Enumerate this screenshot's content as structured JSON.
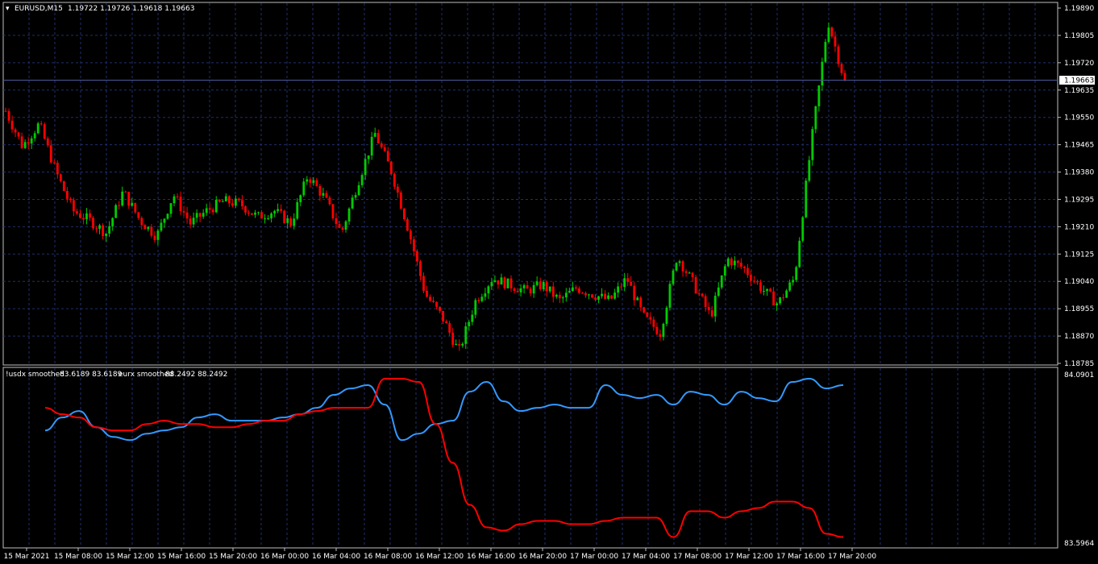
{
  "main_chart": {
    "symbol_timeframe": "EURUSD,M15",
    "ohlc": "1.19722 1.19726 1.19618 1.19663",
    "current_price": "1.19663",
    "price_axis": [
      "1.19890",
      "1.19805",
      "1.19720",
      "1.19635",
      "1.19550",
      "1.19465",
      "1.19380",
      "1.19295",
      "1.19210",
      "1.19125",
      "1.19040",
      "1.18955",
      "1.18870",
      "1.18785"
    ]
  },
  "indicator": {
    "series": [
      {
        "name": "usdx smoothed",
        "label": "!usdx smoothed",
        "values": "83.6189 83.6189",
        "color": "#ff0000"
      },
      {
        "name": "eurx smoothed",
        "label": "eurx smoothed",
        "values": "88.2492 88.2492",
        "color": "#3399ff"
      }
    ],
    "axis_top": "84.0901",
    "axis_bottom": "83.5964"
  },
  "time_axis": [
    "15 Mar 2021",
    "15 Mar 08:00",
    "15 Mar 12:00",
    "15 Mar 16:00",
    "15 Mar 20:00",
    "16 Mar 00:00",
    "16 Mar 04:00",
    "16 Mar 08:00",
    "16 Mar 12:00",
    "16 Mar 16:00",
    "16 Mar 20:00",
    "17 Mar 00:00",
    "17 Mar 04:00",
    "17 Mar 08:00",
    "17 Mar 12:00",
    "17 Mar 16:00",
    "17 Mar 20:00"
  ],
  "colors": {
    "bull": "#00cc00",
    "bear": "#ff0000",
    "grid": "#1f2f6e",
    "axis": "#ffffff",
    "background": "#000000"
  },
  "chart_data": [
    {
      "type": "candlestick",
      "title": "EURUSD,M15",
      "ylim": [
        1.18785,
        1.1989
      ],
      "x": [
        "15 Mar 2021",
        "15 Mar 08:00",
        "15 Mar 12:00",
        "15 Mar 16:00",
        "15 Mar 20:00",
        "16 Mar 00:00",
        "16 Mar 04:00",
        "16 Mar 08:00",
        "16 Mar 12:00",
        "16 Mar 16:00",
        "16 Mar 20:00",
        "17 Mar 00:00",
        "17 Mar 04:00",
        "17 Mar 08:00",
        "17 Mar 12:00",
        "17 Mar 16:00",
        "17 Mar 20:00"
      ],
      "close_path": [
        1.1957,
        1.1946,
        1.1953,
        1.1938,
        1.1926,
        1.1923,
        1.1919,
        1.1932,
        1.1923,
        1.1918,
        1.1931,
        1.1922,
        1.1926,
        1.1929,
        1.1928,
        1.1924,
        1.1926,
        1.1922,
        1.1937,
        1.193,
        1.1919,
        1.1935,
        1.195,
        1.1938,
        1.192,
        1.19,
        1.1893,
        1.1882,
        1.1898,
        1.1905,
        1.1903,
        1.1901,
        1.1903,
        1.1898,
        1.1902,
        1.19,
        1.1898,
        1.1905,
        1.1893,
        1.1888,
        1.1912,
        1.1903,
        1.1893,
        1.1911,
        1.1908,
        1.1902,
        1.1897,
        1.1905,
        1.1947,
        1.1985,
        1.1966
      ],
      "grid": true
    },
    {
      "type": "line",
      "ylim": [
        83.5964,
        84.0901
      ],
      "x": [
        "15 Mar 2021",
        "15 Mar 08:00",
        "15 Mar 12:00",
        "15 Mar 16:00",
        "15 Mar 20:00",
        "16 Mar 00:00",
        "16 Mar 04:00",
        "16 Mar 08:00",
        "16 Mar 12:00",
        "16 Mar 16:00",
        "16 Mar 20:00",
        "17 Mar 00:00",
        "17 Mar 04:00",
        "17 Mar 08:00",
        "17 Mar 12:00",
        "17 Mar 16:00",
        "17 Mar 20:00"
      ],
      "series": [
        {
          "name": "usdx smoothed",
          "values": [
            84.0,
            83.98,
            83.97,
            83.94,
            83.93,
            83.93,
            83.95,
            83.96,
            83.95,
            83.95,
            83.94,
            83.94,
            83.95,
            83.96,
            83.96,
            83.98,
            83.99,
            84.0,
            84.0,
            84.0,
            84.09,
            84.09,
            84.08,
            83.95,
            83.83,
            83.7,
            83.63,
            83.62,
            83.64,
            83.65,
            83.65,
            83.64,
            83.64,
            83.65,
            83.66,
            83.66,
            83.66,
            83.6,
            83.68,
            83.68,
            83.66,
            83.68,
            83.69,
            83.71,
            83.71,
            83.69,
            83.61,
            83.6
          ]
        },
        {
          "name": "eurx smoothed",
          "values": [
            83.93,
            83.97,
            83.99,
            83.94,
            83.91,
            83.9,
            83.92,
            83.93,
            83.94,
            83.97,
            83.98,
            83.96,
            83.96,
            83.96,
            83.97,
            83.98,
            84.0,
            84.04,
            84.06,
            84.07,
            84.01,
            83.9,
            83.92,
            83.95,
            83.96,
            84.05,
            84.08,
            84.02,
            83.99,
            84.0,
            84.01,
            84.0,
            84.0,
            84.07,
            84.04,
            84.03,
            84.04,
            84.01,
            84.05,
            84.04,
            84.01,
            84.05,
            84.03,
            84.02,
            84.08,
            84.09,
            84.06,
            84.07
          ]
        }
      ]
    }
  ]
}
